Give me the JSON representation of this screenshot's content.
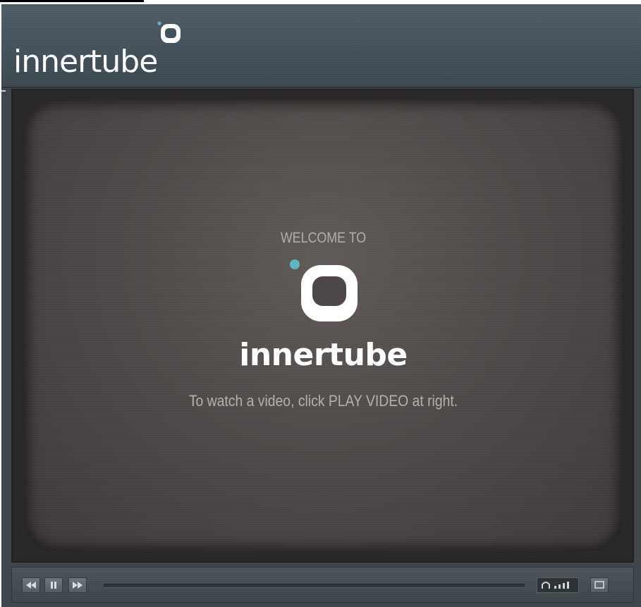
{
  "header": {
    "brand": "innertube"
  },
  "screen": {
    "welcome": "WELCOME TO",
    "brand": "innertube",
    "instruction": "To watch a video, click PLAY VIDEO at right."
  },
  "controls": {
    "buttons": [
      "rewind",
      "pause",
      "fast-forward"
    ],
    "progress": 0,
    "volume_bars": 4
  },
  "colors": {
    "accent_dot": "#5fb6c3",
    "header_bg": "#4a5660",
    "screen_bg": "#55504f"
  },
  "icons": {
    "logo": "innertube-tv-icon",
    "rewind": "rewind-icon",
    "pause": "pause-icon",
    "forward": "fast-forward-icon",
    "volume": "volume-icon",
    "fullscreen": "fullscreen-icon"
  }
}
